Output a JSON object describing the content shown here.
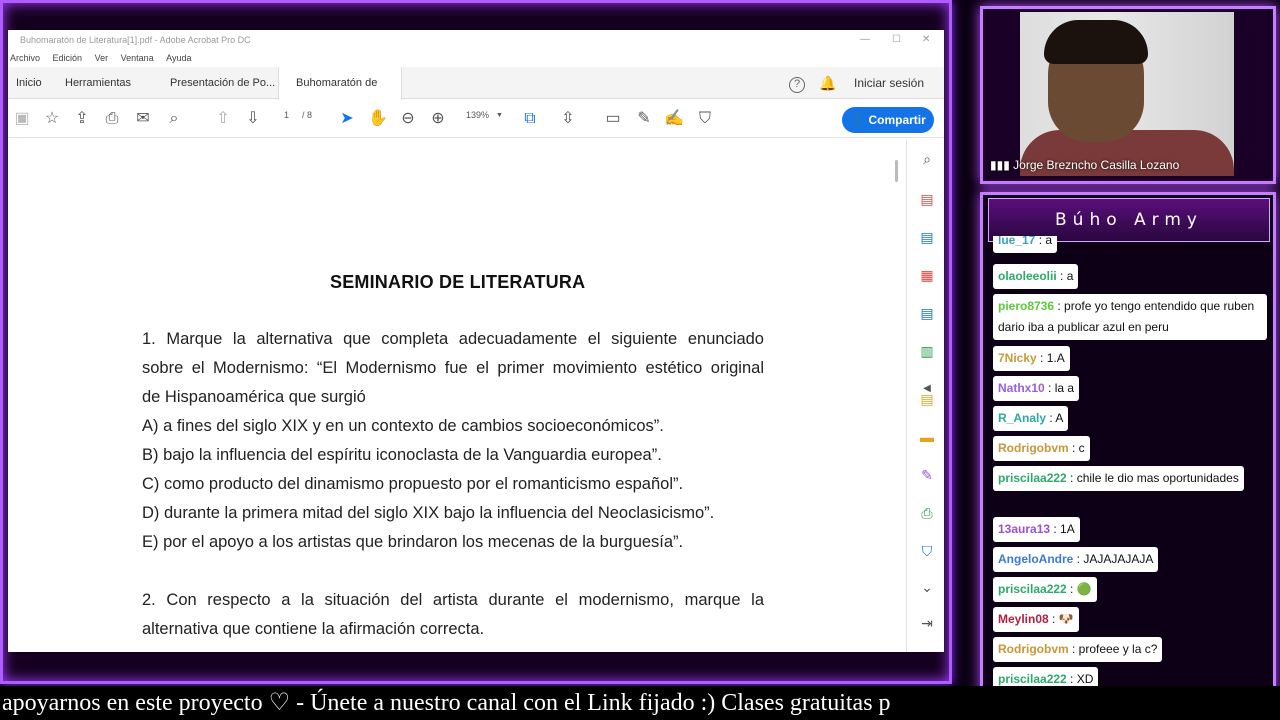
{
  "acrobat": {
    "window_title": "Buhomaratón de Literatura[1].pdf - Adobe Acrobat Pro DC",
    "menu": [
      "Archivo",
      "Edición",
      "Ver",
      "Ventana",
      "Ayuda"
    ],
    "tabs": [
      "Inicio",
      "Herramientas",
      "Presentación de Po...",
      "Buhomaratón de Li..."
    ],
    "tab_close": "×",
    "help_icon": "?",
    "sign_in": "Iniciar sesión",
    "page_current": "1",
    "page_total": "/ 8",
    "zoom": "139%",
    "share_label": "Compartir",
    "accent_color": "#1473e6"
  },
  "document": {
    "title": "SEMINARIO DE LITERATURA",
    "q1_lines": [
      "1. Marque la alternativa que completa adecuadamente el siguiente enunciado",
      "sobre el Modernismo: “El Modernismo fue el primer movimiento estético original",
      "de Hispanoamérica que surgió"
    ],
    "q1_options": [
      "A) a fines del siglo XIX y en un contexto de cambios socioeconómicos”.",
      "B) bajo la influencia del espíritu iconoclasta de la Vanguardia europea”.",
      "C) como producto del dinamismo propuesto por el romanticismo español”.",
      "D) durante la primera mitad del siglo XIX bajo la influencia del Neoclasicismo”.",
      "E) por el apoyo a los artistas que brindaron los mecenas de la burguesía”."
    ],
    "q2_lines": [
      "2. Con respecto a la situación del artista durante el modernismo, marque la",
      "alternativa que contiene la afirmación correcta."
    ]
  },
  "webcam": {
    "name": "Jorge Breznc­ho Casilla Lozano"
  },
  "chat": {
    "title": "Búho Army",
    "messages": [
      {
        "user": "lue_17",
        "text": " : a",
        "color": "#3aa0c8"
      },
      {
        "user": "olaoleeolii",
        "text": " : a",
        "color": "#2fa86b"
      },
      {
        "user": "piero8736",
        "text": " : profe yo tengo entendido que ruben dario iba a publicar azul en peru",
        "color": "#5cc93a"
      },
      {
        "user": "7Nicky",
        "text": " : 1.A",
        "color": "#c89a3a"
      },
      {
        "user": "Nathx10",
        "text": " : la a",
        "color": "#9a5fd6"
      },
      {
        "user": "R_Analy",
        "text": " : A",
        "color": "#2fa8a0"
      },
      {
        "user": "Rodrigobvm",
        "text": " : c",
        "color": "#c8963a"
      },
      {
        "user": "priscilaa222",
        "text": " : chile le dio mas oportunidades",
        "color": "#2fa86b"
      },
      {
        "user": "13aura13",
        "text": " : 1A",
        "color": "#9a4fd6"
      },
      {
        "user": "AngeloAndre",
        "text": " : JAJAJAJAJA",
        "color": "#3a7ad6"
      },
      {
        "user": "priscilaa222",
        "text": " : ",
        "color": "#2fa86b"
      },
      {
        "user": "Meylin08",
        "text": " : ",
        "color": "#b02040"
      },
      {
        "user": "Rodrigobvm",
        "text": " : profeee y la c?",
        "color": "#c8963a"
      },
      {
        "user": "priscilaa222",
        "text": " : XD",
        "color": "#2fa86b"
      }
    ]
  },
  "ticker": {
    "text": "apoyarnos en este proyecto  ♡   -   Únete a nuestro canal con el Link fijado :)  Clases gratuitas p"
  }
}
